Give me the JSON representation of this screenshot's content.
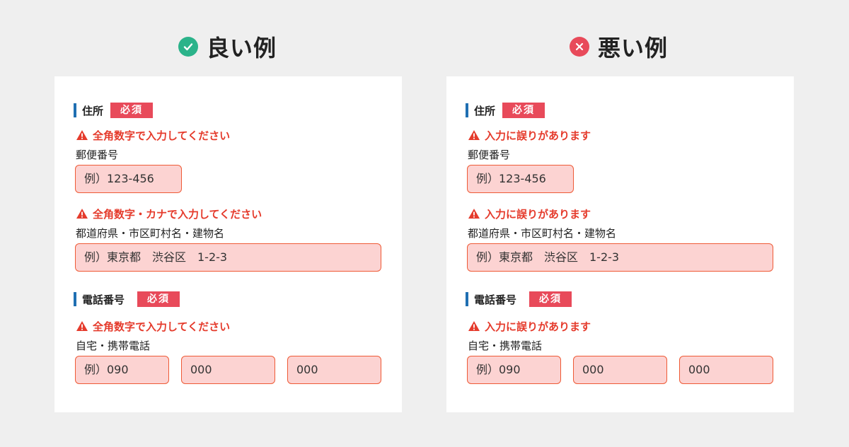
{
  "headers": {
    "good": {
      "title": "良い例",
      "icon": "check-circle-icon"
    },
    "bad": {
      "title": "悪い例",
      "icon": "x-circle-icon"
    }
  },
  "colors": {
    "good_accent": "#2bb38a",
    "bad_accent": "#e84a5a",
    "error_text": "#e53b2c",
    "field_bg": "#fcd3d2",
    "field_border": "#ee5a36",
    "section_bar": "#1f6fb2"
  },
  "good": {
    "address": {
      "heading": "住所",
      "required": "必須",
      "postal": {
        "error": "全角数字で入力してください",
        "label": "郵便番号",
        "value": "例）123-456"
      },
      "street": {
        "error": "全角数字・カナで入力してください",
        "label": "都道府県・市区町村名・建物名",
        "value": "例）東京都　渋谷区　1-2-3"
      }
    },
    "phone": {
      "heading": "電話番号",
      "required": "必須",
      "error": "全角数字で入力してください",
      "label": "自宅・携帯電話",
      "part1": "例）090",
      "part2": "000",
      "part3": "000"
    }
  },
  "bad": {
    "address": {
      "heading": "住所",
      "required": "必須",
      "postal": {
        "error": "入力に誤りがあります",
        "label": "郵便番号",
        "value": "例）123-456"
      },
      "street": {
        "error": "入力に誤りがあります",
        "label": "都道府県・市区町村名・建物名",
        "value": "例）東京都　渋谷区　1-2-3"
      }
    },
    "phone": {
      "heading": "電話番号",
      "required": "必須",
      "error": "入力に誤りがあります",
      "label": "自宅・携帯電話",
      "part1": "例）090",
      "part2": "000",
      "part3": "000"
    }
  }
}
